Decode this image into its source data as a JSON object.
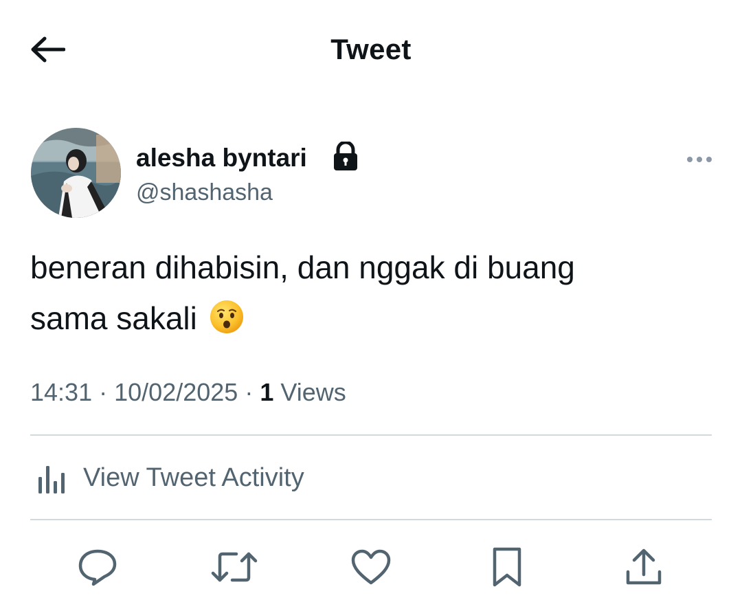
{
  "header": {
    "title": "Tweet",
    "back_icon": "arrow-left-icon"
  },
  "author": {
    "display_name": "alesha byntari",
    "handle": "@shashasha",
    "protected_icon": "lock-icon",
    "more_icon": "more-horizontal-icon"
  },
  "tweet": {
    "text_line1": "beneran dihabisin, dan nggak di buang",
    "text_line2": "sama sakali",
    "emoji": "hushed-face-emoji"
  },
  "meta": {
    "time": "14:31",
    "separator": "·",
    "date": "10/02/2025",
    "views_count": "1",
    "views_label": "Views"
  },
  "activity": {
    "label": "View Tweet Activity",
    "icon": "bar-chart-icon"
  },
  "actions": [
    {
      "name": "reply",
      "icon": "reply-icon"
    },
    {
      "name": "retweet",
      "icon": "retweet-icon"
    },
    {
      "name": "like",
      "icon": "heart-icon"
    },
    {
      "name": "bookmark",
      "icon": "bookmark-icon"
    },
    {
      "name": "share",
      "icon": "share-icon"
    }
  ],
  "colors": {
    "text_primary": "#0f1419",
    "text_secondary": "#536471",
    "divider": "#cfd9de",
    "background": "#ffffff"
  }
}
